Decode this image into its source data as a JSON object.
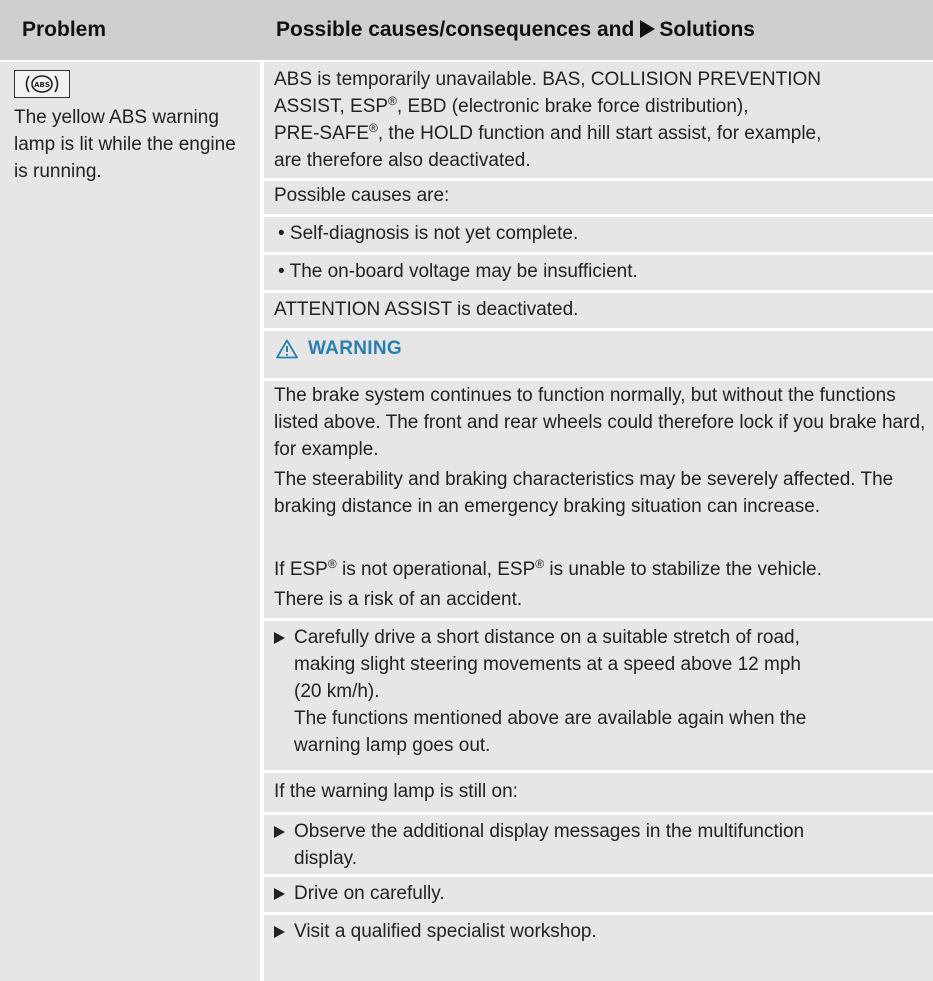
{
  "header": {
    "problem": "Problem",
    "causes": "Possible causes/consequences and",
    "solutions": "Solutions"
  },
  "problem": {
    "icon": "abs-warning-lamp-icon",
    "text": "The yellow ABS warning lamp is lit while the engine is running."
  },
  "content": {
    "p1_line1": "ABS is temporarily unavailable. BAS, COLLISION PREVENTION",
    "p1_line2a": "ASSIST, ESP",
    "p1_line2b": ", EBD (electronic brake force distribution),",
    "p1_line3a": "PRE-SAFE",
    "p1_line3b": ", the HOLD function and hill start assist, for example,",
    "p1_line4": "are therefore also deactivated.",
    "registered": "®",
    "causes_intro": "Possible causes are:",
    "bullets": [
      "• Self-diagnosis is not yet complete.",
      "• The on-board voltage may be insufficient."
    ],
    "attention": "ATTENTION ASSIST is deactivated."
  },
  "warning": {
    "title": "WARNING",
    "para1": "The brake system continues to function normally, but without the functions listed above. The front and rear wheels could therefore lock if you brake hard, for example.",
    "para2": "The steerability and braking characteristics may be severely affected. The braking distance in an emergency braking situation can increase.",
    "para3a": "If ESP",
    "para3b": " is not operational, ESP",
    "para3c": " is unable to stabilize the vehicle.",
    "para4": "There is a risk of an accident."
  },
  "steps": {
    "s1_line1": "Carefully drive a short distance on a suitable stretch of road,",
    "s1_line2": "making slight steering movements at a speed above 12 mph",
    "s1_line3": "(20 km/h).",
    "s1_line4": "The functions mentioned above are available again when the",
    "s1_line5": "warning lamp goes out.",
    "still_on": "If the warning lamp is still on:",
    "s2_line1": "Observe the additional display messages in the multifunction",
    "s2_line2": "display.",
    "s3": "Drive on carefully.",
    "s4": "Visit a qualified specialist workshop."
  },
  "colors": {
    "header_bg": "#cfcfcf",
    "cell_bg": "#e6e6e6",
    "warning_accent": "#2a7fb0"
  }
}
